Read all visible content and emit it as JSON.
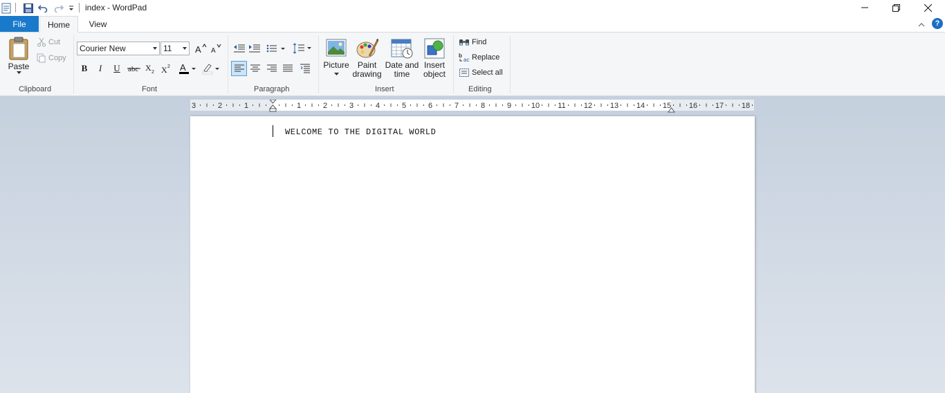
{
  "window": {
    "title": "index - WordPad"
  },
  "tabs": [
    {
      "label": "File"
    },
    {
      "label": "Home"
    },
    {
      "label": "View"
    }
  ],
  "ribbon": {
    "clipboard": {
      "label": "Clipboard",
      "paste": "Paste",
      "cut": "Cut",
      "copy": "Copy"
    },
    "font": {
      "label": "Font",
      "family": "Courier New",
      "size": "11"
    },
    "paragraph": {
      "label": "Paragraph"
    },
    "insert": {
      "label": "Insert",
      "picture": "Picture",
      "paint_line1": "Paint",
      "paint_line2": "drawing",
      "datetime_line1": "Date and",
      "datetime_line2": "time",
      "object_line1": "Insert",
      "object_line2": "object"
    },
    "editing": {
      "label": "Editing",
      "find": "Find",
      "replace": "Replace",
      "select_all": "Select all"
    }
  },
  "ruler": {
    "labels": [
      "3",
      "2",
      "1",
      "1",
      "2",
      "3",
      "4",
      "5",
      "6",
      "7",
      "8",
      "9",
      "10",
      "11",
      "12",
      "13",
      "14",
      "15",
      "16",
      "17",
      "18"
    ]
  },
  "document": {
    "text": "WELCOME TO THE DIGITAL WORLD"
  },
  "colors": {
    "accent": "#1979ca",
    "ribbon_bg": "#f5f6f7",
    "workspace_bg": "#c8d3e0",
    "font_color_bar": "#000000",
    "highlight_bar": "#ffffff"
  }
}
